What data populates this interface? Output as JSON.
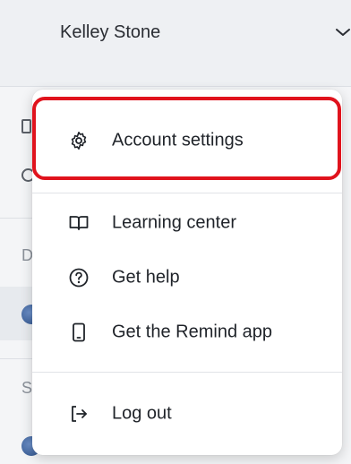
{
  "header": {
    "user_name": "Kelley Stone"
  },
  "background_sidebar": {
    "section_letters": [
      "D",
      "S"
    ]
  },
  "menu": {
    "items": [
      {
        "label": "Account settings",
        "icon": "gear-icon",
        "highlighted": true
      },
      {
        "label": "Learning center",
        "icon": "open-book-icon"
      },
      {
        "label": "Get help",
        "icon": "question-circle-icon"
      },
      {
        "label": "Get the Remind app",
        "icon": "phone-icon"
      },
      {
        "label": "Log out",
        "icon": "log-out-icon"
      }
    ]
  },
  "colors": {
    "highlight_border": "#e0131d",
    "menu_background": "#ffffff",
    "header_background": "#eef0f3"
  }
}
